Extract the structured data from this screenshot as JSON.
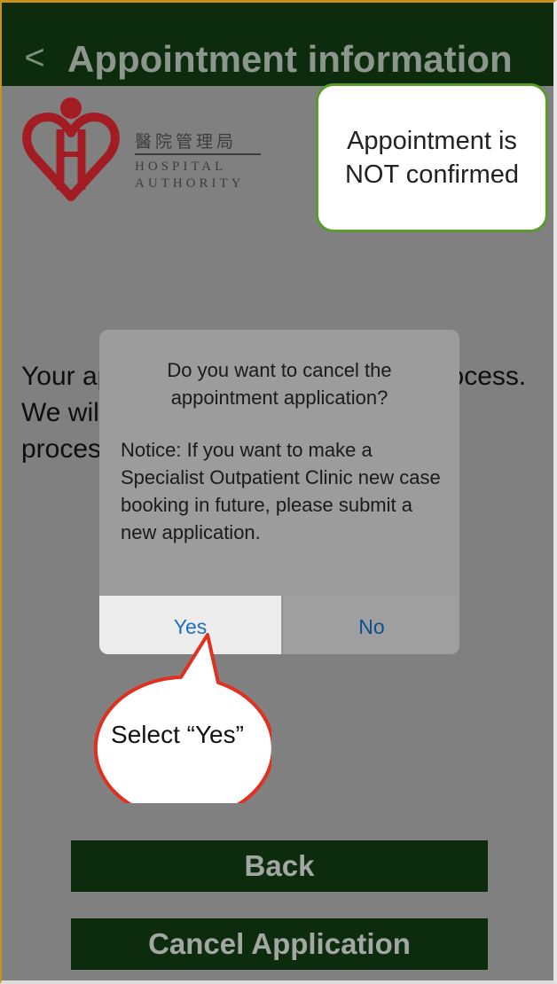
{
  "nav": {
    "back_glyph": "<",
    "title": "Appointment information"
  },
  "logo": {
    "chinese": "醫院管理局",
    "english_line1": "HOSPITAL",
    "english_line2": "AUTHORITY"
  },
  "annotation_note": "Appointment is NOT confirmed",
  "status_text": {
    "line1": "Your appointment application is in process.",
    "line2": "We will notify you by SMS after the",
    "line3": "processing."
  },
  "dialog": {
    "title": "Do you want to cancel the appointment application?",
    "message": "Notice: If you want to make a Specialist Outpatient Clinic new case booking in future, please submit a new application.",
    "yes_label": "Yes",
    "no_label": "No"
  },
  "callout_label": "Select “Yes”",
  "buttons": {
    "back": "Back",
    "cancel_application": "Cancel Application"
  },
  "colors": {
    "nav_bar": "#0d2c0d",
    "overlay": "#808080",
    "logo_red": "#a31c24",
    "note_border": "#5a9a2c",
    "callout_border": "#e03020",
    "dialog_button_text": "#1f6fbf"
  },
  "icons": {
    "back": "chevron-left-icon",
    "logo": "hospital-authority-heart-logo"
  }
}
